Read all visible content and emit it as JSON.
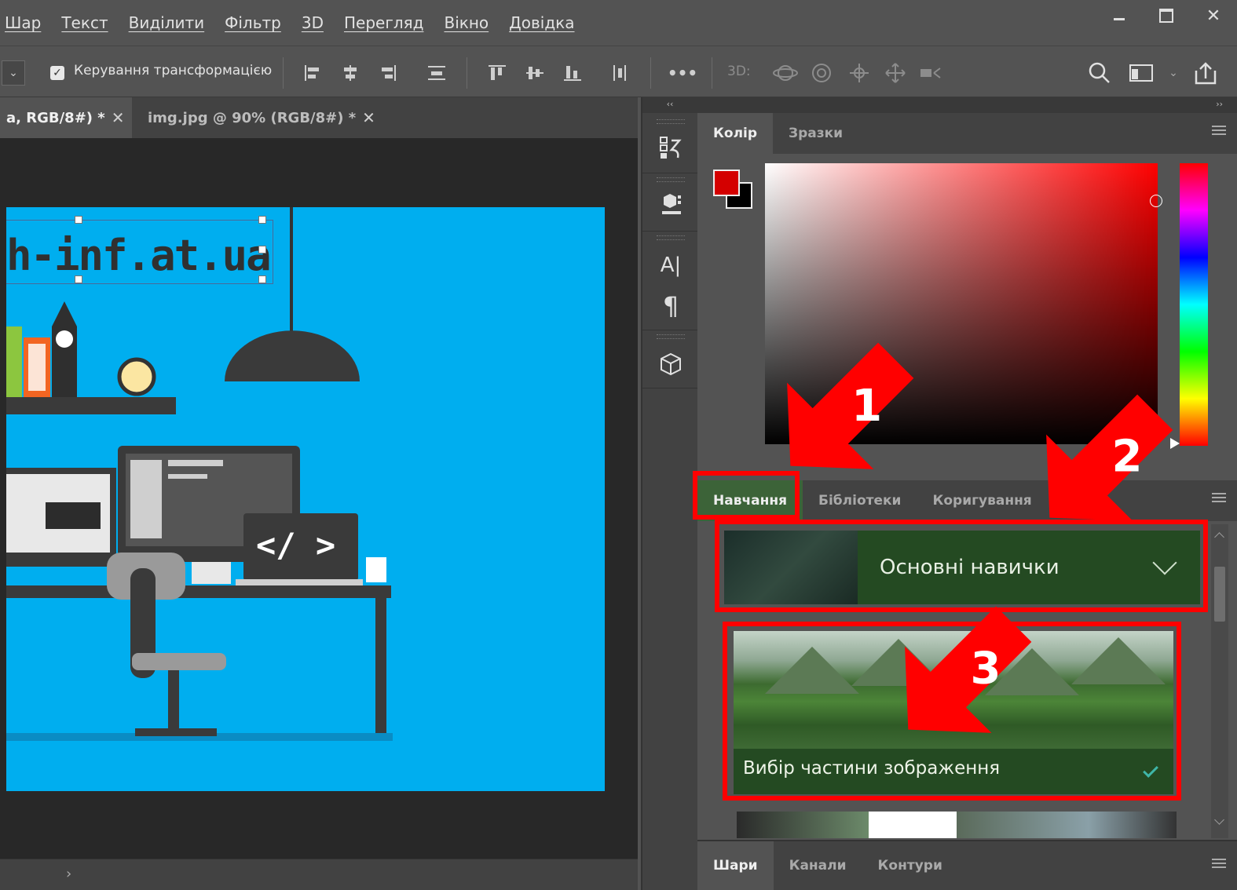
{
  "menu": {
    "items": [
      "Шар",
      "Текст",
      "Виділити",
      "Фільтр",
      "3D",
      "Перегляд",
      "Вікно",
      "Довідка"
    ]
  },
  "window_controls": {
    "close": "✕"
  },
  "options_bar": {
    "transform_controls_label": "Керування трансформацією",
    "more_label": "•••",
    "label_3d": "3D:"
  },
  "documents": [
    {
      "title": "а, RGB/8#) *",
      "close": "✕",
      "active": true
    },
    {
      "title": "img.jpg @ 90% (RGB/8#) *",
      "close": "✕",
      "active": false
    }
  ],
  "canvas": {
    "text": "h-inf.at.ua",
    "code_label": "</ >"
  },
  "tool_strip": {
    "collapse": "‹‹",
    "text_tool": "A|",
    "paragraph": "¶"
  },
  "panel_header": {
    "expand": "››"
  },
  "color_panel": {
    "tabs": [
      "Колір",
      "Зразки"
    ],
    "foreground_color": "#d40000",
    "background_color": "#000000"
  },
  "learn_panel": {
    "tabs": [
      "Навчання",
      "Бібліотеки",
      "Коригування"
    ],
    "skills_title": "Основні навички",
    "lesson_title": "Вибір частини зображення"
  },
  "layers_panel": {
    "tabs": [
      "Шари",
      "Канали",
      "Контури"
    ]
  },
  "annotations": {
    "arrow1": "1",
    "arrow2": "2",
    "arrow3": "3",
    "color": "#ff0000"
  },
  "statusbar": {
    "scroll": "›"
  }
}
